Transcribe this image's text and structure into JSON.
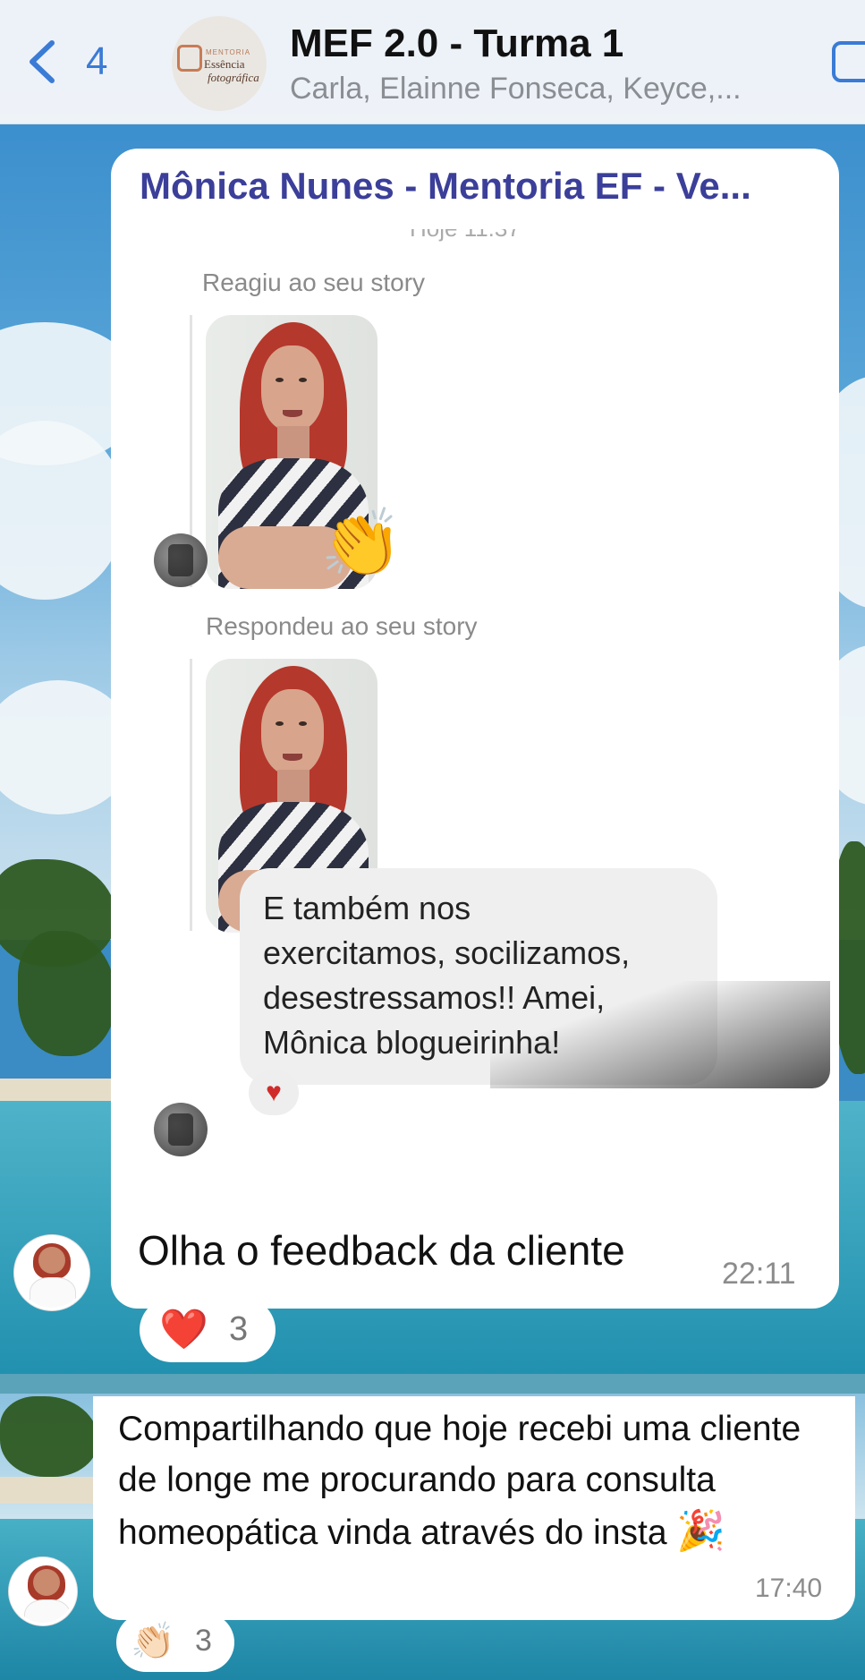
{
  "header": {
    "back_count": "4",
    "title": "MEF 2.0 - Turma 1",
    "subtitle": "Carla, Elainne Fonseca, Keyce,...",
    "group_avatar": {
      "top": "MENTORIA",
      "mid": "Essência",
      "bot": "fotográfica"
    }
  },
  "message1": {
    "sender": "Mônica Nunes - Mentoria EF - Ve...",
    "screenshot": {
      "cut_time": "Hoje 11:37",
      "label_reacted": "Reagiu ao seu story",
      "label_replied": "Respondeu ao seu story",
      "reaction_icon": "clapping-hands-icon",
      "inner_message": "E também nos\nexercitamos,  socilizamos,\ndesestressamos!! Amei,\nMônica blogueirinha!",
      "inner_reaction": "♥"
    },
    "caption": "Olha o feedback da cliente",
    "time": "22:11",
    "reaction": {
      "emoji": "❤️",
      "icon": "heart-icon",
      "count": "3"
    }
  },
  "message2": {
    "text": "Compartilhando que hoje recebi uma cliente de longe me procurando para consulta homeopática vinda através do insta",
    "emoji": "🎉",
    "time": "17:40",
    "reaction": {
      "emoji": "👏🏻",
      "icon": "clapping-hands-icon",
      "count": "3"
    }
  },
  "colors": {
    "accent": "#3a7bd5",
    "sender": "#3b3f99",
    "heart": "#d02b2b"
  }
}
